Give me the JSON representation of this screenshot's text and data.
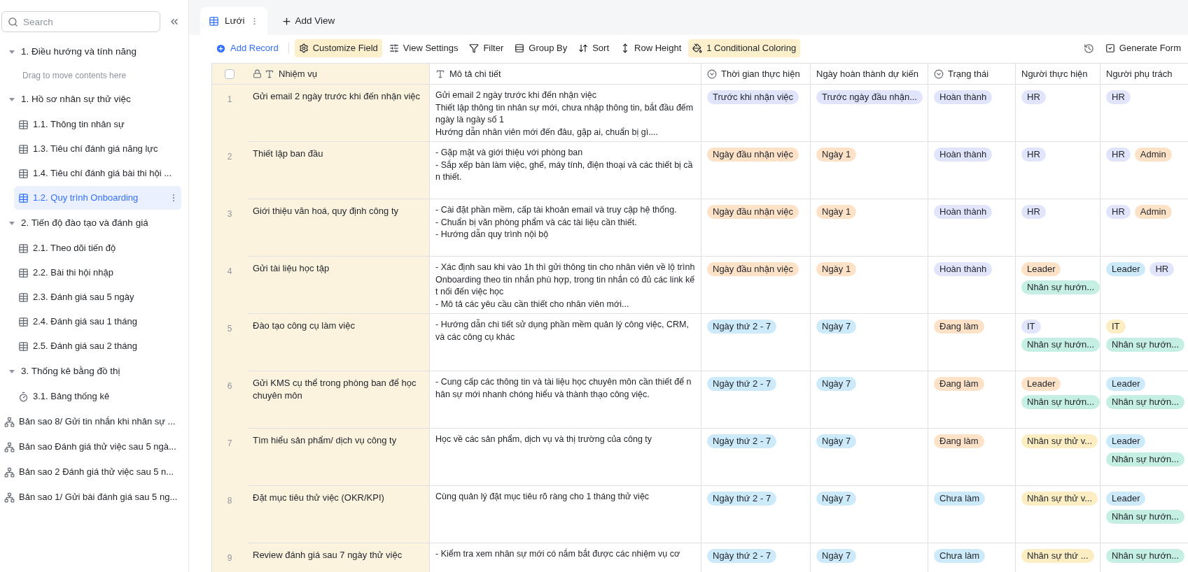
{
  "sidebar": {
    "search": {
      "placeholder": "Search"
    },
    "items": [
      {
        "kind": "group",
        "label": "1. Điều hướng và tính năng",
        "expanded": true,
        "children": [
          {
            "kind": "hint",
            "label": "Drag to move contents here"
          }
        ]
      },
      {
        "kind": "group",
        "label": "1. Hồ sơ nhân sự thử việc",
        "expanded": true,
        "children": [
          {
            "kind": "table",
            "label": "1.1. Thông tin nhân sự",
            "selected": false
          },
          {
            "kind": "table",
            "label": "1.3. Tiêu chí đánh giá năng lực",
            "selected": false
          },
          {
            "kind": "table",
            "label": "1.4. Tiêu chí đánh giá bài thi hội ...",
            "selected": false
          },
          {
            "kind": "table",
            "label": "1.2. Quy trình Onboarding",
            "selected": true
          }
        ]
      },
      {
        "kind": "group",
        "label": "2. Tiến độ đào tạo và đánh giá",
        "expanded": true,
        "children": [
          {
            "kind": "table",
            "label": "2.1. Theo dõi tiến độ",
            "selected": false
          },
          {
            "kind": "table",
            "label": "2.2. Bài thi hội nhập",
            "selected": false
          },
          {
            "kind": "table",
            "label": "2.3. Đánh giá sau 5 ngày",
            "selected": false
          },
          {
            "kind": "table",
            "label": "2.4. Đánh giá sau 1 tháng",
            "selected": false
          },
          {
            "kind": "table",
            "label": "2.5. Đánh giá sau 2 tháng",
            "selected": false
          }
        ]
      },
      {
        "kind": "group",
        "label": "3. Thống kê bằng đồ thị",
        "expanded": true,
        "children": [
          {
            "kind": "dashboard",
            "label": "3.1. Bảng thống kê",
            "selected": false
          }
        ]
      },
      {
        "kind": "workflow",
        "label": "Bản sao 8/ Gửi tin nhắn khi nhân sự ...",
        "selected": false
      },
      {
        "kind": "workflow",
        "label": "Bản sao Đánh giá thử việc sau 5 ngà...",
        "selected": false
      },
      {
        "kind": "workflow",
        "label": "Bản sao 2 Đánh giá thử việc sau 5 n...",
        "selected": false
      },
      {
        "kind": "workflow",
        "label": "Bản sao 1/ Gửi bài đánh giá sau 5 ng...",
        "selected": false
      }
    ]
  },
  "tabs": [
    {
      "kind": "view",
      "label": "Lưới",
      "selected": true
    },
    {
      "kind": "add",
      "label": "Add View"
    }
  ],
  "toolbar": {
    "left": [
      {
        "kind": "add",
        "label": "Add Record",
        "active": false
      },
      {
        "kind": "customize",
        "label": "Customize Field",
        "active": true
      },
      {
        "kind": "settings",
        "label": "View Settings",
        "active": false
      },
      {
        "kind": "filter",
        "label": "Filter",
        "active": false
      },
      {
        "kind": "group",
        "label": "Group By",
        "active": false
      },
      {
        "kind": "sort",
        "label": "Sort",
        "active": false
      },
      {
        "kind": "height",
        "label": "Row Height",
        "active": false
      },
      {
        "kind": "coloring",
        "label": "1 Conditional Coloring",
        "active": true
      }
    ],
    "right": [
      {
        "kind": "history"
      },
      {
        "kind": "form",
        "label": "Generate Form"
      }
    ]
  },
  "table": {
    "select_all": {
      "checked": false
    },
    "columns": [
      {
        "kind": "primary",
        "label": "Nhiệm vụ"
      },
      {
        "kind": "text",
        "label": "Mô tả chi tiết"
      },
      {
        "kind": "select",
        "label": "Thời gian thực hiện"
      },
      {
        "kind": "plain",
        "label": "Ngày hoàn thành dự kiến"
      },
      {
        "kind": "select",
        "label": "Trạng thái"
      },
      {
        "kind": "plain",
        "label": "Người thực hiện"
      },
      {
        "kind": "plain",
        "label": "Người phụ trách"
      }
    ],
    "rows": [
      {
        "number": "1",
        "task": "Gửi email 2 ngày trước khi đến nhận việc",
        "description": "Gửi email 2 ngày trước khi đến nhận việc\nThiết lập thông tin nhân sự mới, chưa nhập thông tin, bắt đầu đếm ngày là ngày số 1\nHướng dẫn nhân viên mới đến đâu, gặp ai, chuẩn bị gì....",
        "time": [
          {
            "label": "Trước khi nhận việc",
            "color": "#e1e5fb"
          }
        ],
        "due": [
          {
            "label": "Trước ngày đầu nhận...",
            "color": "#e1e5fb"
          }
        ],
        "status": [
          {
            "label": "Hoàn thành",
            "color": "#e1e5fb"
          }
        ],
        "assignees": [
          {
            "label": "HR",
            "color": "#e1e5fb"
          }
        ],
        "owners": [
          {
            "label": "HR",
            "color": "#e1e5fb"
          }
        ]
      },
      {
        "number": "2",
        "task": "Thiết lập ban đầu",
        "description": "- Gặp mặt và giới thiệu với phòng ban\n- Sắp xếp bàn làm việc, ghế, máy tính, điện thoại và các thiết bị cần thiết.",
        "time": [
          {
            "label": "Ngày đầu nhận việc",
            "color": "#fde2c8"
          }
        ],
        "due": [
          {
            "label": "Ngày 1",
            "color": "#fde2c8"
          }
        ],
        "status": [
          {
            "label": "Hoàn thành",
            "color": "#e1e5fb"
          }
        ],
        "assignees": [
          {
            "label": "HR",
            "color": "#e1e5fb"
          }
        ],
        "owners": [
          {
            "label": "HR",
            "color": "#e1e5fb"
          },
          {
            "label": "Admin",
            "color": "#fde2c8"
          }
        ]
      },
      {
        "number": "3",
        "task": "Giới thiệu văn hoá, quy định công ty",
        "description": "- Cài đặt phần mềm, cấp tài khoản email và truy cập hệ thống.\n- Chuẩn bị văn phòng phẩm và các tài liệu cần thiết.\n- Hướng dẫn quy trình nội bộ",
        "time": [
          {
            "label": "Ngày đầu nhận việc",
            "color": "#fde2c8"
          }
        ],
        "due": [
          {
            "label": "Ngày 1",
            "color": "#fde2c8"
          }
        ],
        "status": [
          {
            "label": "Hoàn thành",
            "color": "#e1e5fb"
          }
        ],
        "assignees": [
          {
            "label": "HR",
            "color": "#e1e5fb"
          }
        ],
        "owners": [
          {
            "label": "HR",
            "color": "#e1e5fb"
          },
          {
            "label": "Admin",
            "color": "#fde2c8"
          }
        ]
      },
      {
        "number": "4",
        "task": "Gửi tài liệu học tập",
        "description": "- Xác định sau khi vào 1h thì gửi thông tin cho nhân viên về lộ trình Onboarding theo tin nhắn phù hợp, trong tin nhắn có đủ các link kết nối đến việc học\n- Mô tả các yêu cầu cần thiết cho nhân viên mới...",
        "time": [
          {
            "label": "Ngày đầu nhận việc",
            "color": "#fde2c8"
          }
        ],
        "due": [
          {
            "label": "Ngày 1",
            "color": "#fde2c8"
          }
        ],
        "status": [
          {
            "label": "Hoàn thành",
            "color": "#e1e5fb"
          }
        ],
        "assignees": [
          {
            "label": "Leader",
            "color": "#fde2c8"
          },
          {
            "label": "Nhân sự hướn...",
            "color": "#c6efe3"
          }
        ],
        "owners": [
          {
            "label": "Leader",
            "color": "#cdeafa"
          },
          {
            "label": "HR",
            "color": "#e1e5fb"
          }
        ]
      },
      {
        "number": "5",
        "task": "Đào tạo công cụ làm việc",
        "description": "- Hướng dẫn chi tiết sử dụng phần mềm quản lý công việc, CRM, và các công cụ khác",
        "time": [
          {
            "label": "Ngày thứ 2 - 7",
            "color": "#cdeafa"
          }
        ],
        "due": [
          {
            "label": "Ngày 7",
            "color": "#cdeafa"
          }
        ],
        "status": [
          {
            "label": "Đang làm",
            "color": "#fde2c8"
          }
        ],
        "assignees": [
          {
            "label": "IT",
            "color": "#e1e5fb"
          },
          {
            "label": "Nhân sự hướn...",
            "color": "#c6efe3"
          }
        ],
        "owners": [
          {
            "label": "IT",
            "color": "#fcedc3"
          },
          {
            "label": "Nhân sự hướn...",
            "color": "#c6efe3"
          }
        ]
      },
      {
        "number": "6",
        "task": "Gửi KMS cụ thể trong phòng ban để học chuyên môn",
        "description": "- Cung cấp các thông tin và tài liệu học chuyên môn cần thiết để nhân sự mới nhanh chóng hiểu và thành thạo công việc.",
        "time": [
          {
            "label": "Ngày thứ 2 - 7",
            "color": "#cdeafa"
          }
        ],
        "due": [
          {
            "label": "Ngày 7",
            "color": "#cdeafa"
          }
        ],
        "status": [
          {
            "label": "Đang làm",
            "color": "#fde2c8"
          }
        ],
        "assignees": [
          {
            "label": "Leader",
            "color": "#fde2c8"
          },
          {
            "label": "Nhân sự hướn...",
            "color": "#c6efe3"
          }
        ],
        "owners": [
          {
            "label": "Leader",
            "color": "#cdeafa"
          },
          {
            "label": "Nhân sự hướn...",
            "color": "#c6efe3"
          }
        ]
      },
      {
        "number": "7",
        "task": "Tìm hiểu sản phẩm/ dịch vụ công ty",
        "description": "Học về các sản phẩm, dịch vụ và thị trường của công ty",
        "time": [
          {
            "label": "Ngày thứ 2 - 7",
            "color": "#cdeafa"
          }
        ],
        "due": [
          {
            "label": "Ngày 7",
            "color": "#cdeafa"
          }
        ],
        "status": [
          {
            "label": "Đang làm",
            "color": "#fde2c8"
          }
        ],
        "assignees": [
          {
            "label": "Nhân sự thử v...",
            "color": "#fcedc3"
          }
        ],
        "owners": [
          {
            "label": "Leader",
            "color": "#cdeafa"
          },
          {
            "label": "Nhân sự hướn...",
            "color": "#c6efe3"
          }
        ]
      },
      {
        "number": "8",
        "task": "Đặt mục tiêu thử việc (OKR/KPI)",
        "description": "Cùng quản lý đặt mục tiêu rõ ràng cho 1 tháng thử việc",
        "time": [
          {
            "label": "Ngày thứ 2 - 7",
            "color": "#cdeafa"
          }
        ],
        "due": [
          {
            "label": "Ngày 7",
            "color": "#cdeafa"
          }
        ],
        "status": [
          {
            "label": "Chưa làm",
            "color": "#cdeafa"
          }
        ],
        "assignees": [
          {
            "label": "Nhân sự thử v...",
            "color": "#fcedc3"
          }
        ],
        "owners": [
          {
            "label": "Leader",
            "color": "#cdeafa"
          },
          {
            "label": "Nhân sự hướn...",
            "color": "#c6efe3"
          }
        ]
      },
      {
        "number": "9",
        "task": "Review đánh giá sau 7 ngày thử việc",
        "description": "- Kiểm tra xem nhân sự mới có nắm bắt được các nhiệm vụ cơ",
        "time": [
          {
            "label": "Ngày thứ 2 - 7",
            "color": "#cdeafa"
          }
        ],
        "due": [
          {
            "label": "Ngày 7",
            "color": "#cdeafa"
          }
        ],
        "status": [
          {
            "label": "Chưa làm",
            "color": "#cdeafa"
          }
        ],
        "assignees": [
          {
            "label": "Nhân sự thứ ...",
            "color": "#fcedc3"
          }
        ],
        "owners": [
          {
            "label": "Nhân sự hướn...",
            "color": "#c6efe3"
          }
        ]
      }
    ]
  }
}
